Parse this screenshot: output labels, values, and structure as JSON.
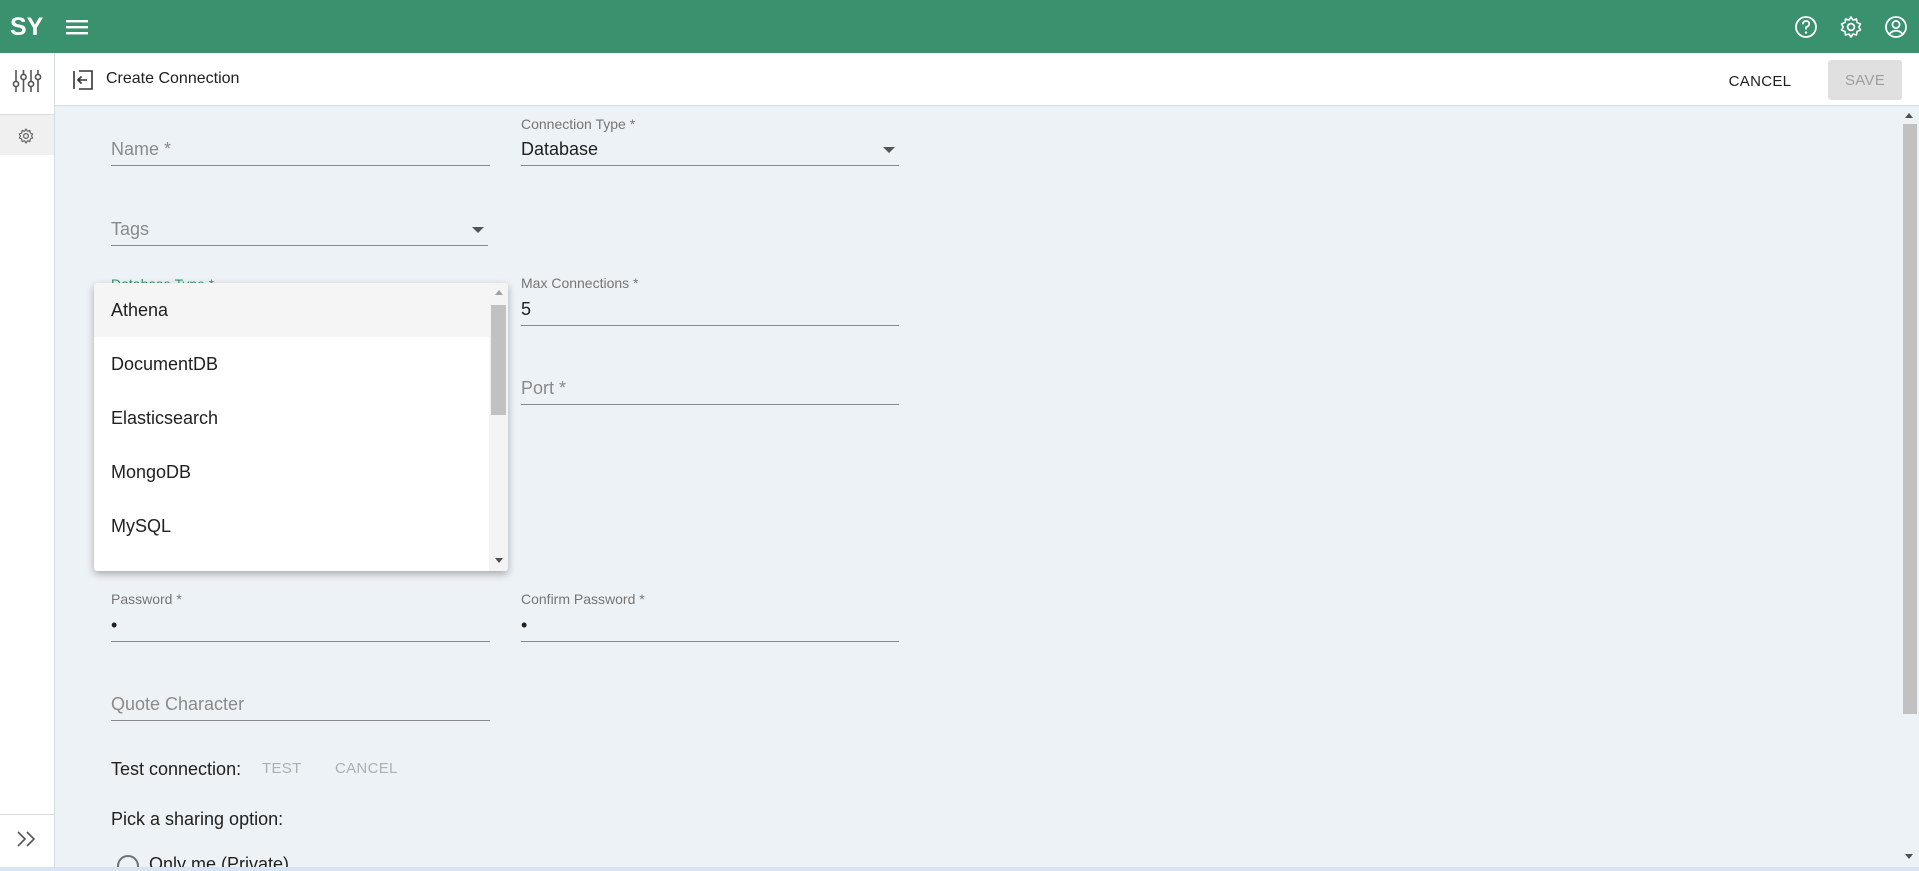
{
  "topbar": {
    "logo_text": "SY",
    "icons": [
      "menu-icon",
      "help-icon",
      "gear-icon",
      "account-icon"
    ],
    "color": "#3a916d"
  },
  "rail": {
    "icons": [
      "sliders-icon",
      "gear-icon",
      "double-chevron-right-icon"
    ]
  },
  "header": {
    "title": "Create Connection",
    "cancel_label": "CANCEL",
    "save_label": "SAVE"
  },
  "form": {
    "name": {
      "placeholder": "Name *"
    },
    "connection_type": {
      "label": "Connection Type *",
      "value": "Database"
    },
    "tags": {
      "placeholder": "Tags"
    },
    "database_type": {
      "label": "Database Type *"
    },
    "max_connections": {
      "label": "Max Connections *",
      "value": "5"
    },
    "port": {
      "placeholder": "Port *"
    },
    "password": {
      "label": "Password *",
      "value": "•"
    },
    "confirm_password": {
      "label": "Confirm Password *",
      "value": "•"
    },
    "quote_character": {
      "placeholder": "Quote Character"
    }
  },
  "dropdown": {
    "options": [
      "Athena",
      "DocumentDB",
      "Elasticsearch",
      "MongoDB",
      "MySQL"
    ],
    "highlighted": "Athena"
  },
  "test": {
    "label": "Test connection:",
    "test_label": "TEST",
    "cancel_label": "CANCEL"
  },
  "sharing": {
    "label": "Pick a sharing option:",
    "option_private": "Only me (Private)"
  }
}
